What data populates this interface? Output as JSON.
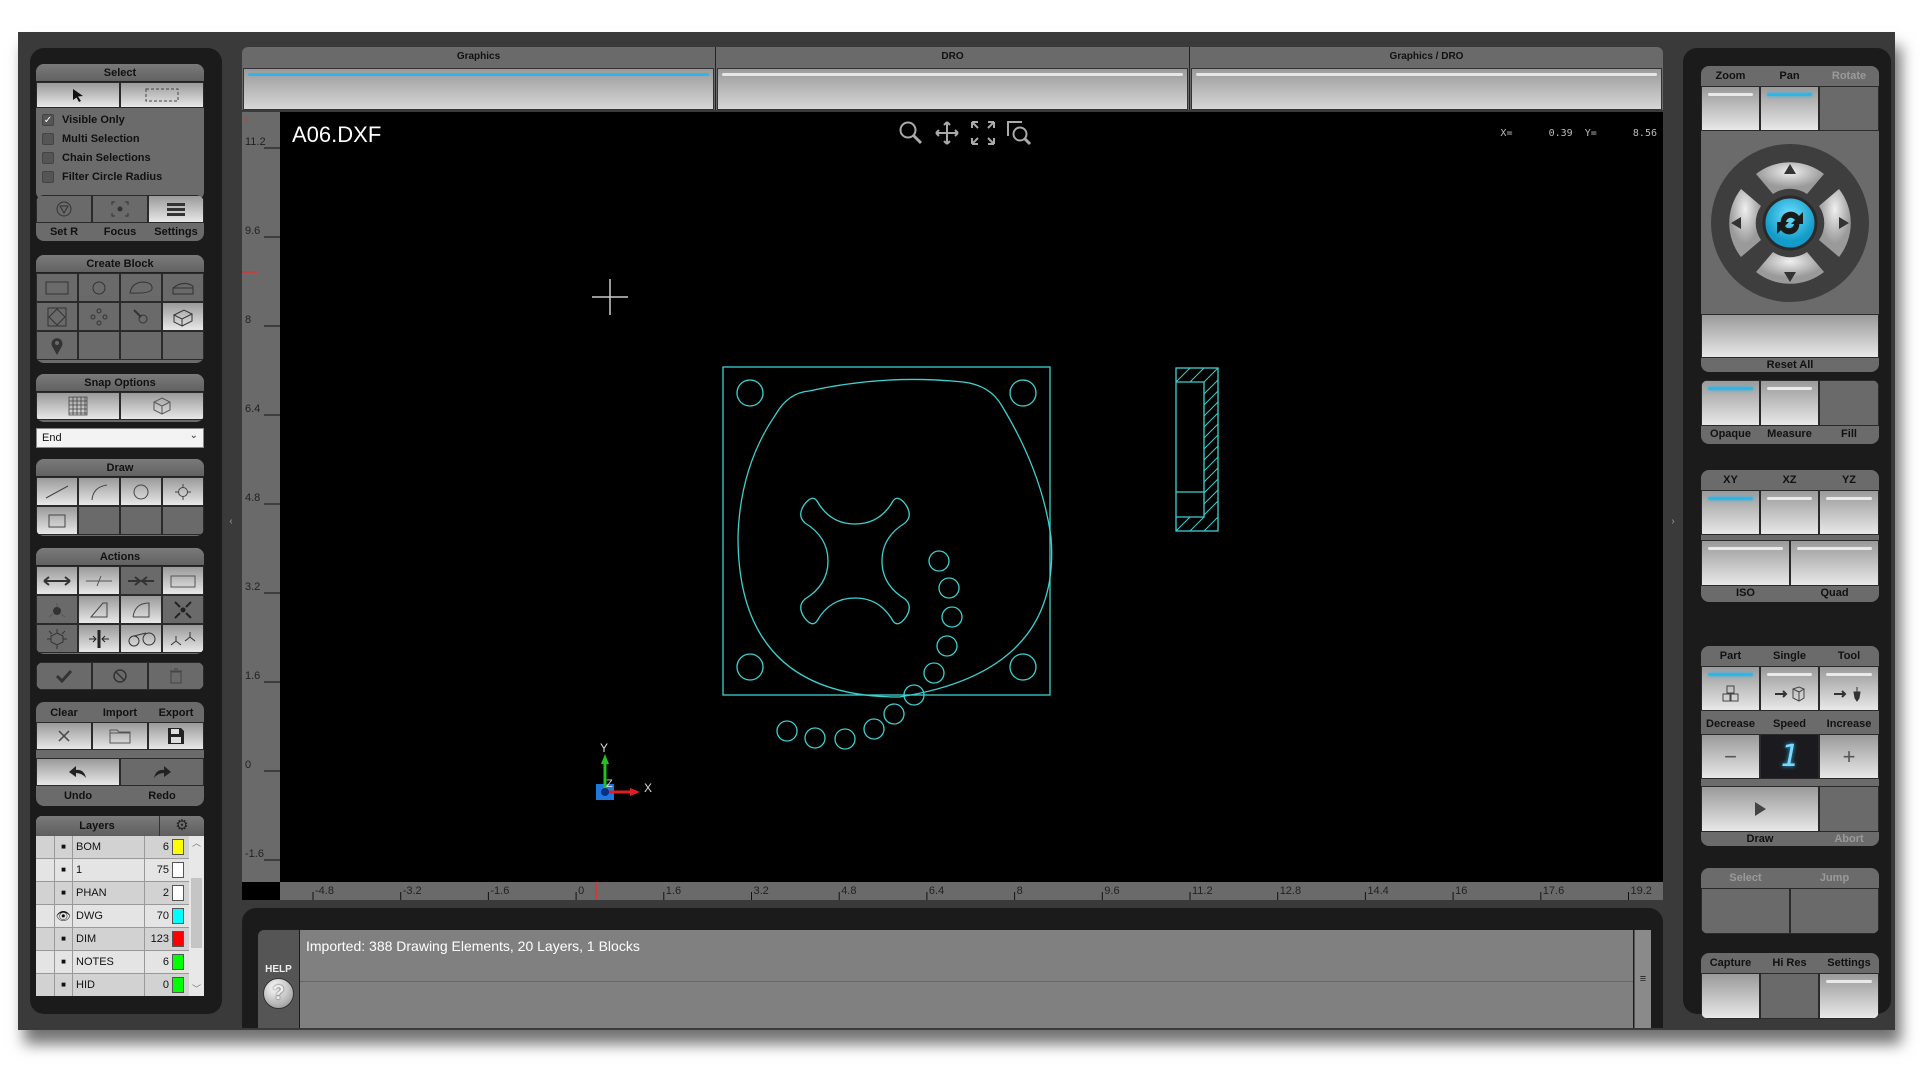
{
  "select_group": {
    "title": "Select",
    "options": [
      {
        "label": "Visible Only",
        "checked": true
      },
      {
        "label": "Multi Selection",
        "checked": false
      },
      {
        "label": "Chain Selections",
        "checked": false
      },
      {
        "label": "Filter Circle Radius",
        "checked": false
      }
    ],
    "tools": [
      "Set R",
      "Focus",
      "Settings"
    ]
  },
  "create_block": {
    "title": "Create Block"
  },
  "snap_options": {
    "title": "Snap Options",
    "mode": "End"
  },
  "draw_group": {
    "title": "Draw"
  },
  "actions_group": {
    "title": "Actions"
  },
  "file_group": {
    "clear": "Clear",
    "import": "Import",
    "export": "Export",
    "undo": "Undo",
    "redo": "Redo"
  },
  "layers": {
    "title": "Layers",
    "rows": [
      {
        "name": "BOM",
        "count": "6",
        "color": "#ffff00",
        "visible": false
      },
      {
        "name": "1",
        "count": "75",
        "color": "#ffffff",
        "visible": false
      },
      {
        "name": "PHAN",
        "count": "2",
        "color": "#ffffff",
        "visible": false
      },
      {
        "name": "DWG",
        "count": "70",
        "color": "#00ffff",
        "visible": true
      },
      {
        "name": "DIM",
        "count": "123",
        "color": "#ff0000",
        "visible": false
      },
      {
        "name": "NOTES",
        "count": "6",
        "color": "#00ff00",
        "visible": false
      },
      {
        "name": "HID",
        "count": "0",
        "color": "#00ff00",
        "visible": false
      }
    ]
  },
  "tabs": [
    {
      "label": "Graphics",
      "active": true
    },
    {
      "label": "DRO",
      "active": false
    },
    {
      "label": "Graphics / DRO",
      "active": false
    }
  ],
  "canvas": {
    "filename": "A06.DXF",
    "coord_x_label": "X=",
    "coord_x": "0.39",
    "coord_y_label": "Y=",
    "coord_y": "8.56",
    "y_ticks": [
      "11.2",
      "9.6",
      "8",
      "6.4",
      "4.8",
      "3.2",
      "1.6",
      "0",
      "-1.6"
    ],
    "x_ticks": [
      "-4.8",
      "-3.2",
      "-1.6",
      "0",
      "1.6",
      "3.2",
      "4.8",
      "6.4",
      "8",
      "9.6",
      "11.2",
      "12.8",
      "14.4",
      "16",
      "17.6",
      "19.2"
    ],
    "axis_x": "X",
    "axis_y": "Y",
    "axis_z": "Z",
    "accent": "#2ab7ec",
    "drawing_color": "#3fd0d0"
  },
  "message": {
    "help_label": "HELP",
    "text": "Imported: 388 Drawing Elements, 20 Layers, 1 Blocks"
  },
  "right": {
    "view_mode": {
      "zoom": "Zoom",
      "pan": "Pan",
      "rotate": "Rotate",
      "reset": "Reset All"
    },
    "display": {
      "opaque": "Opaque",
      "measure": "Measure",
      "fill": "Fill"
    },
    "views": {
      "xy": "XY",
      "xz": "XZ",
      "yz": "YZ",
      "iso": "ISO",
      "quad": "Quad"
    },
    "run": {
      "part": "Part",
      "single": "Single",
      "tool": "Tool",
      "decrease": "Decrease",
      "speed": "Speed",
      "increase": "Increase",
      "speed_value": "1",
      "draw": "Draw",
      "abort": "Abort"
    },
    "nav": {
      "select": "Select",
      "jump": "Jump"
    },
    "capture": {
      "capture": "Capture",
      "hires": "Hi Res",
      "settings": "Settings"
    }
  }
}
